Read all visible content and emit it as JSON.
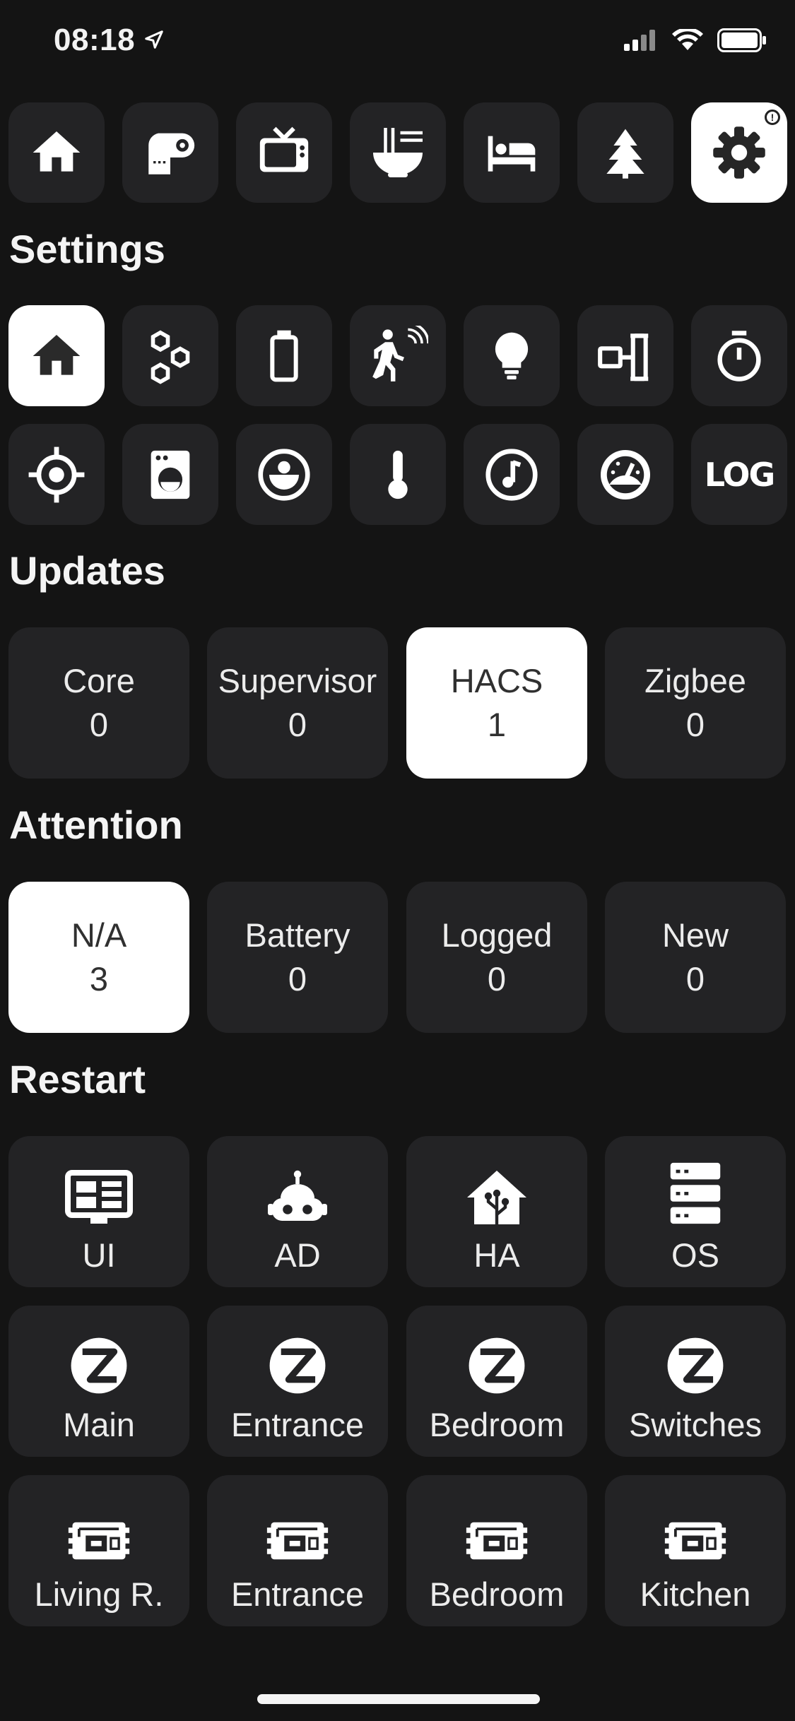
{
  "status_bar": {
    "time": "08:18"
  },
  "top_nav": {
    "items": [
      {
        "icon": "home-icon"
      },
      {
        "icon": "toilet-paper-icon"
      },
      {
        "icon": "tv-icon"
      },
      {
        "icon": "noodle-bowl-icon"
      },
      {
        "icon": "bed-icon"
      },
      {
        "icon": "pine-tree-icon"
      },
      {
        "icon": "gear-icon",
        "active": true,
        "badge": "!"
      }
    ]
  },
  "settings": {
    "title": "Settings",
    "row1": [
      "home-icon",
      "hexagon-cluster-icon",
      "battery-icon",
      "motion-sensor-icon",
      "lightbulb-icon",
      "radiator-valve-icon",
      "timer-icon"
    ],
    "row2": [
      "crosshair-icon",
      "washing-machine-icon",
      "robot-vacuum-icon",
      "thermometer-icon",
      "music-note-icon",
      "gauge-icon",
      "log-icon"
    ],
    "log_text": "LOG"
  },
  "updates": {
    "title": "Updates",
    "items": [
      {
        "label": "Core",
        "value": "0"
      },
      {
        "label": "Supervisor",
        "value": "0"
      },
      {
        "label": "HACS",
        "value": "1",
        "active": true
      },
      {
        "label": "Zigbee",
        "value": "0"
      }
    ]
  },
  "attention": {
    "title": "Attention",
    "items": [
      {
        "label": "N/A",
        "value": "3",
        "active": true
      },
      {
        "label": "Battery",
        "value": "0"
      },
      {
        "label": "Logged",
        "value": "0"
      },
      {
        "label": "New",
        "value": "0"
      }
    ]
  },
  "restart": {
    "title": "Restart",
    "row1": [
      {
        "label": "UI",
        "icon": "dashboard-icon"
      },
      {
        "label": "AD",
        "icon": "robot-icon"
      },
      {
        "label": "HA",
        "icon": "home-assistant-icon"
      },
      {
        "label": "OS",
        "icon": "server-icon"
      }
    ],
    "row2": [
      {
        "label": "Main",
        "icon": "zigbee-icon"
      },
      {
        "label": "Entrance",
        "icon": "zigbee-icon"
      },
      {
        "label": "Bedroom",
        "icon": "zigbee-icon"
      },
      {
        "label": "Switches",
        "icon": "zigbee-icon"
      }
    ],
    "row3": [
      {
        "label": "Living R.",
        "icon": "esp-chip-icon"
      },
      {
        "label": "Entrance",
        "icon": "esp-chip-icon"
      },
      {
        "label": "Bedroom",
        "icon": "esp-chip-icon"
      },
      {
        "label": "Kitchen",
        "icon": "esp-chip-icon"
      }
    ]
  },
  "colors": {
    "background": "#141414",
    "tile": "#232325",
    "active_tile": "#ffffff",
    "text": "#ececec"
  }
}
